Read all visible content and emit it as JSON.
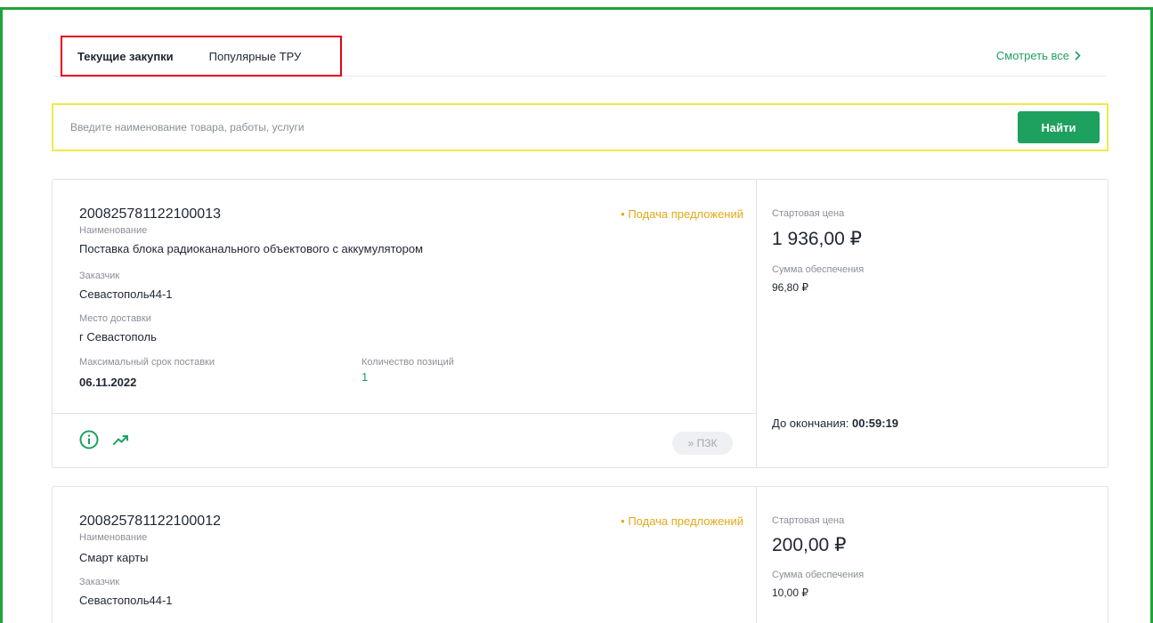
{
  "tabs": {
    "active": "Текущие закупки",
    "second": "Популярные ТРУ",
    "see_all": "Смотреть все"
  },
  "search": {
    "placeholder": "Введите наименование товара, работы, услуги",
    "button": "Найти"
  },
  "cards": [
    {
      "number": "200825781122100013",
      "status": "• Подача предложений",
      "name_label": "Наименование",
      "name": "Поставка блока радиоканального объектового с аккумулятором",
      "customer_label": "Заказчик",
      "customer": "Севастополь44-1",
      "delivery_label": "Место доставки",
      "delivery": "г Севастополь",
      "deadline_label": "Максимальный срок поставки",
      "deadline": "06.11.2022",
      "positions_label": "Количество позиций",
      "positions": "1",
      "start_price_label": "Стартовая цена",
      "start_price": "1 936,00 ₽",
      "security_label": "Сумма обеспечения",
      "security": "96,80 ₽",
      "until_end_label": "До окончания:",
      "until_end": "00:59:19",
      "pzk_button": "» ПЗК"
    },
    {
      "number": "200825781122100012",
      "status": "• Подача предложений",
      "name_label": "Наименование",
      "name": "Смарт карты",
      "customer_label": "Заказчик",
      "customer": "Севастополь44-1",
      "start_price_label": "Стартовая цена",
      "start_price": "200,00 ₽",
      "security_label": "Сумма обеспечения",
      "security": "10,00 ₽"
    }
  ],
  "colors": {
    "accent": "#1ea05f",
    "status": "#e2a918",
    "frame": "#1fa33a",
    "tabs_highlight": "#e3001b",
    "search_highlight": "#f1e84a"
  },
  "icons": {
    "info": "info-circle-icon",
    "trend": "trending-up-icon",
    "chevron": "chevron-right-icon"
  }
}
